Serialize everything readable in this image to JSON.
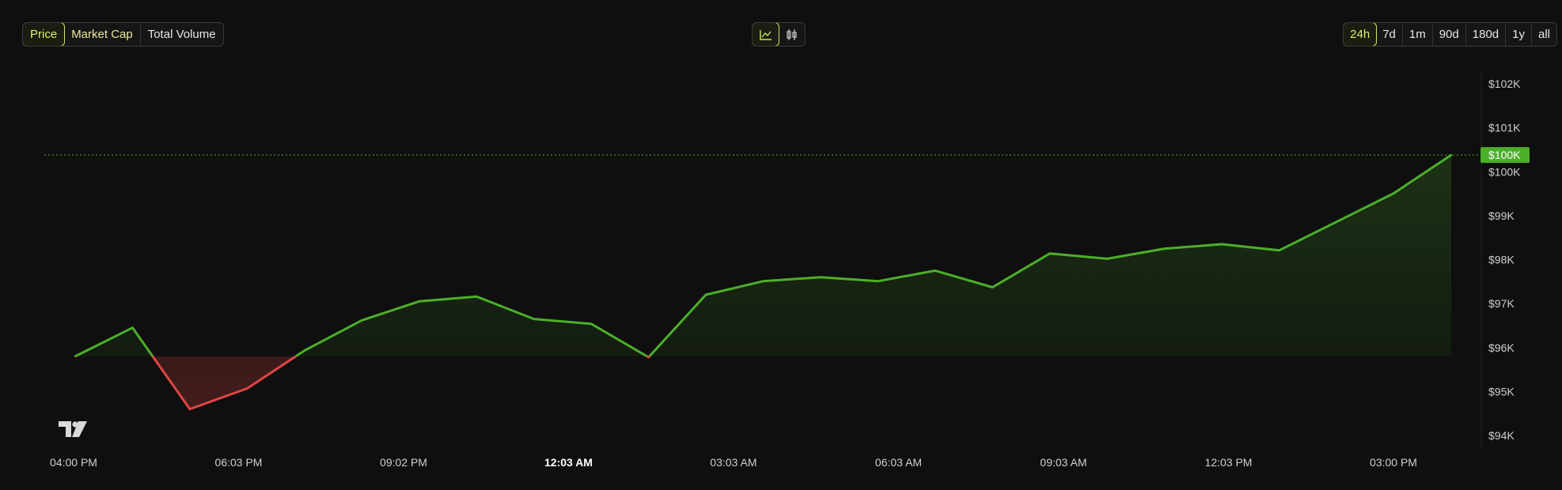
{
  "toolbar": {
    "metric_tabs": [
      {
        "label": "Price",
        "active": true
      },
      {
        "label": "Market Cap",
        "active": false
      },
      {
        "label": "Total Volume",
        "active": false
      }
    ],
    "chart_type_toggle": [
      {
        "icon": "line-chart-icon",
        "active": true
      },
      {
        "icon": "candlestick-chart-icon",
        "active": false
      }
    ],
    "range_tabs": [
      {
        "label": "24h",
        "active": true
      },
      {
        "label": "7d",
        "active": false
      },
      {
        "label": "1m",
        "active": false
      },
      {
        "label": "90d",
        "active": false
      },
      {
        "label": "180d",
        "active": false
      },
      {
        "label": "1y",
        "active": false
      },
      {
        "label": "all",
        "active": false
      }
    ]
  },
  "colors": {
    "up": "#4caf2a",
    "down": "#e04545",
    "accent": "#c5e85a",
    "background": "#0f0f0f"
  },
  "chart_data": {
    "type": "line",
    "title": "",
    "xlabel": "",
    "ylabel": "",
    "x_tick_labels": [
      "04:00 PM",
      "06:03 PM",
      "09:02 PM",
      "12:03 AM",
      "03:03 AM",
      "06:03 AM",
      "09:03 AM",
      "12:03 PM",
      "03:00 PM"
    ],
    "x_tick_bold": "12:03 AM",
    "y_tick_labels": [
      "$102K",
      "$101K",
      "$100K",
      "$99K",
      "$98K",
      "$97K",
      "$96K",
      "$95K",
      "$94K"
    ],
    "ylim": [
      94000,
      102000
    ],
    "baseline": 95800,
    "current_price_label": "$100K",
    "current_price": 100380,
    "series": [
      {
        "values": [
          95800,
          96450,
          94600,
          95070,
          95930,
          96620,
          97050,
          97160,
          96650,
          96540,
          95780,
          97200,
          97510,
          97600,
          97510,
          97750,
          97370,
          98140,
          98020,
          98250,
          98350,
          98210,
          98860,
          99510,
          100380
        ]
      }
    ]
  }
}
